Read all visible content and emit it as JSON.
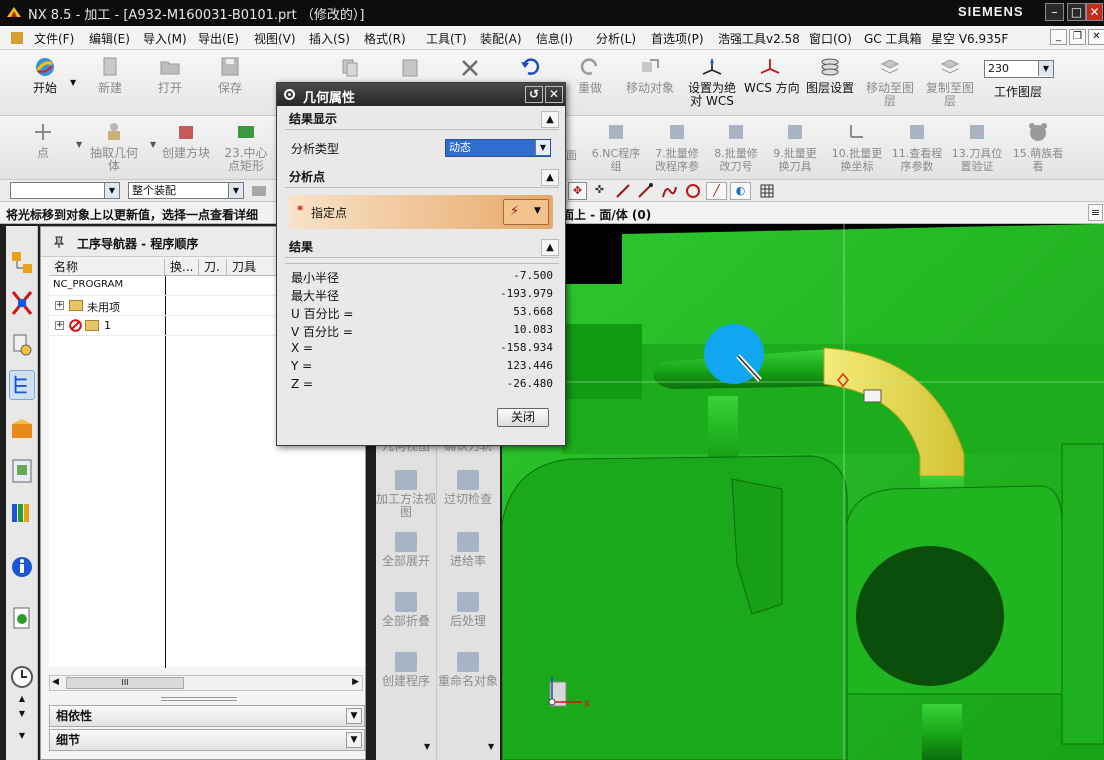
{
  "window": {
    "app": "NX 8.5 - 加工 - [A932-M160031-B0101.prt （修改的）]",
    "brand": "SIEMENS",
    "mdi_restore": "❐",
    "mdi_close": "✕"
  },
  "menu": [
    "文件(F)",
    "编辑(E)",
    "导入(M)",
    "导出(E)",
    "视图(V)",
    "插入(S)",
    "格式(R)",
    "工具(T)",
    "装配(A)",
    "信息(I)",
    "分析(L)",
    "首选项(P)",
    "浩强工具v2.58",
    "窗口(O)",
    "GC 工具箱",
    "星空 V6.935F"
  ],
  "toolbar_standard": {
    "start": "开始",
    "new": "新建",
    "open": "打开",
    "save": "保存",
    "undo": "重做",
    "move_object": "移动对象",
    "set_wcs": "设置为绝对 WCS",
    "wcs_direction": "WCS 方向",
    "layer_settings": "图层设置",
    "move_to_layer": "移动至图层",
    "copy_to_layer": "复制至图层",
    "layer_value": "230",
    "work_layer": "工作图层"
  },
  "toolbar_cam": {
    "point": "点",
    "extract_geom": "抽取几何体",
    "create_block": "创建方块",
    "center_rect": "23.中心点矩形",
    "face": "面",
    "nc_group": "6.NC程序组",
    "batch_params": "7.批量修改程序参",
    "batch_tool": "8.批量修改刀号",
    "batch_replace_tool": "9.批量更换刀具",
    "batch_coord": "10.批量更换坐标",
    "view_params": "11.查看程序参数",
    "tool_check": "13.刀具位置验证",
    "cute": "15.萌族看看"
  },
  "selection": {
    "filter": "",
    "scope": "整个装配"
  },
  "cue": {
    "prompt": "将光标移到对象上以更新值，选择一点查看详细",
    "status": "面上 - 面/体 (0)"
  },
  "navigator": {
    "title": "工序导航器 - 程序顺序",
    "columns": [
      "名称",
      "换...",
      "刀.",
      "刀具"
    ],
    "rows": [
      {
        "name": "NC_PROGRAM"
      },
      {
        "name": "未用项"
      },
      {
        "name": "1"
      }
    ],
    "scroll_grip": "III",
    "panels": [
      "相依性",
      "细节"
    ]
  },
  "palette": {
    "geometry_view": "几何视图",
    "confirm_tool": "确认刀轨",
    "machining_view": "加工方法视图",
    "overcut_check": "过切检查",
    "expand_all": "全部展开",
    "feedrate": "进给率",
    "collapse_all": "全部折叠",
    "post_process": "后处理",
    "create_program": "创建程序",
    "rename_object": "重命名对象"
  },
  "dialog": {
    "title": "几何属性",
    "section_display": "结果显示",
    "analysis_type_label": "分析类型",
    "analysis_type_value": "动态",
    "section_point": "分析点",
    "specify_point": "指定点",
    "section_results": "结果",
    "results": [
      {
        "label": "最小半径",
        "value": "-7.500"
      },
      {
        "label": "最大半径",
        "value": "-193.979"
      },
      {
        "label": "U 百分比 =",
        "value": "53.668"
      },
      {
        "label": "V 百分比 =",
        "value": "10.083"
      },
      {
        "label": "X =",
        "value": "-158.934"
      },
      {
        "label": "Y =",
        "value": "123.446"
      },
      {
        "label": "Z =",
        "value": "-26.480"
      }
    ],
    "close": "关闭"
  },
  "colors": {
    "model_green": "#1fbb1f",
    "highlight_yellow": "#e7dc4a",
    "cursor_blue": "#10a6f0",
    "annotation_red": "#e01010"
  }
}
